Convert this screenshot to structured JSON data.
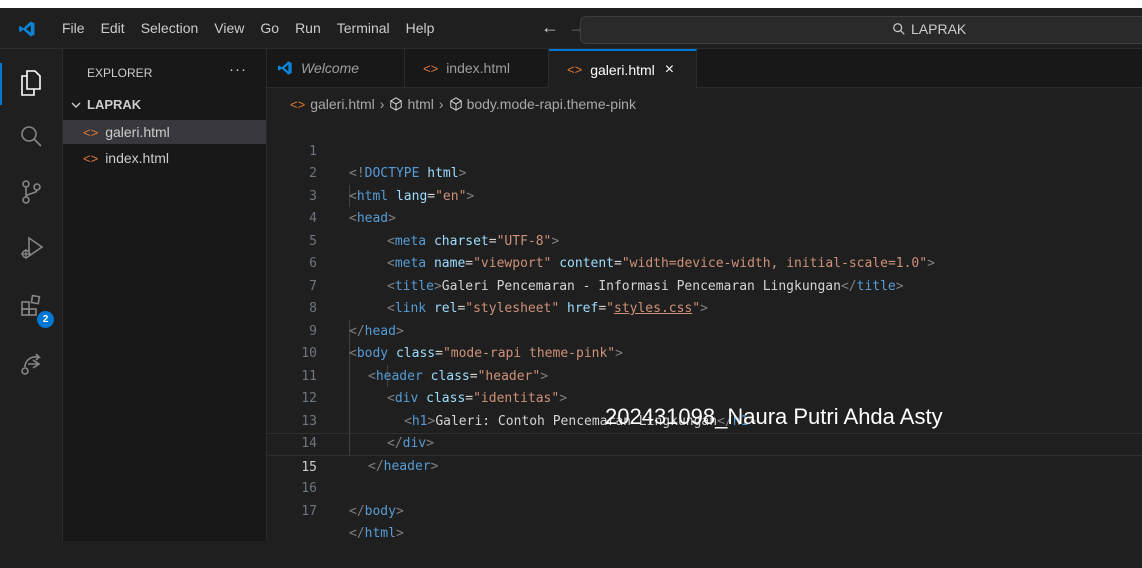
{
  "menu": [
    "File",
    "Edit",
    "Selection",
    "View",
    "Go",
    "Run",
    "Terminal",
    "Help"
  ],
  "search": {
    "text": "LAPRAK"
  },
  "activity_bar": {
    "extensions_badge": "2"
  },
  "explorer": {
    "header": "EXPLORER",
    "more": "···",
    "folder": "LAPRAK",
    "files": [
      "galeri.html",
      "index.html"
    ],
    "active_file": "galeri.html"
  },
  "tabs": [
    {
      "label": "Welcome",
      "icon": "vscode-icon"
    },
    {
      "label": "index.html",
      "icon": "html-file-icon"
    },
    {
      "label": "galeri.html",
      "icon": "html-file-icon",
      "active": true,
      "close": "×"
    }
  ],
  "breadcrumb": {
    "file": "galeri.html",
    "items": [
      "html",
      "body.mode-rapi.theme-pink"
    ]
  },
  "editor": {
    "current_line": 15,
    "lines": [
      {
        "n": "1"
      },
      {
        "n": "2"
      },
      {
        "n": "3"
      },
      {
        "n": "4"
      },
      {
        "n": "5"
      },
      {
        "n": "6"
      },
      {
        "n": "7"
      },
      {
        "n": "8"
      },
      {
        "n": "9"
      },
      {
        "n": "10"
      },
      {
        "n": "11"
      },
      {
        "n": "12"
      },
      {
        "n": "13"
      },
      {
        "n": "14"
      },
      {
        "n": "15"
      },
      {
        "n": "16"
      },
      {
        "n": "17"
      }
    ],
    "code": {
      "l1": [
        "<!",
        "DOCTYPE",
        " ",
        "html",
        ">"
      ],
      "l2": [
        "<",
        "html",
        " ",
        "lang",
        "=",
        "\"en\"",
        ">"
      ],
      "l3": [
        "<",
        "head",
        ">"
      ],
      "l4": [
        "<",
        "meta",
        " ",
        "charset",
        "=",
        "\"UTF-8\"",
        ">"
      ],
      "l5": [
        "<",
        "meta",
        " ",
        "name",
        "=",
        "\"viewport\"",
        " ",
        "content",
        "=",
        "\"width=device-width, initial-scale=1.0\"",
        ">"
      ],
      "l6": [
        "<",
        "title",
        ">",
        "Galeri Pencemaran - Informasi Pencemaran Lingkungan",
        "</",
        "title",
        ">"
      ],
      "l7": [
        "<",
        "link",
        " ",
        "rel",
        "=",
        "\"stylesheet\"",
        " ",
        "href",
        "=",
        "\"",
        "styles.css",
        "\"",
        ">"
      ],
      "l8": [
        "</",
        "head",
        ">"
      ],
      "l9": [
        "<",
        "body",
        " ",
        "class",
        "=",
        "\"mode-rapi theme-pink\"",
        ">"
      ],
      "l10": [
        "<",
        "header",
        " ",
        "class",
        "=",
        "\"header\"",
        ">"
      ],
      "l11": [
        "<",
        "div",
        " ",
        "class",
        "=",
        "\"identitas\"",
        ">"
      ],
      "l12": [
        "<",
        "h1",
        ">",
        "Galeri: Contoh Pencemaran Lingkungan",
        "</",
        "h1",
        ">"
      ],
      "l13": [
        "</",
        "div",
        ">"
      ],
      "l14": [
        "</",
        "header",
        ">"
      ],
      "l16": [
        "</",
        "body",
        ">"
      ],
      "l17": [
        "</",
        "html",
        ">"
      ]
    }
  },
  "overlay_text": "202431098_Naura Putri Ahda Asty",
  "colors": {
    "accent": "#0078d4",
    "html_icon": "#e37933"
  }
}
